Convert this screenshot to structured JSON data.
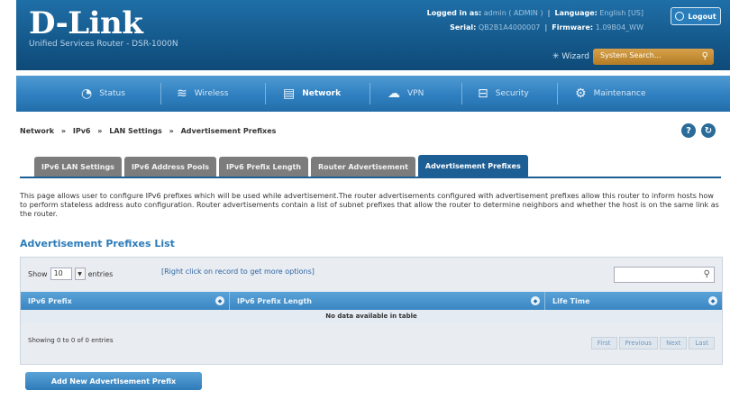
{
  "header": {
    "brand": "D-Link",
    "subtitle": "Unified Services Router - DSR-1000N",
    "logged_in_label": "Logged in as:",
    "logged_in_value": "admin ( ADMIN )",
    "language_label": "Language:",
    "language_value": "English [US]",
    "serial_label": "Serial:",
    "serial_value": "QB2B1A4000007",
    "firmware_label": "Firmware:",
    "firmware_value": "1.09B04_WW",
    "logout_label": "Logout",
    "wizard_label": "Wizard",
    "search_placeholder": "System Search..."
  },
  "nav": {
    "items": [
      {
        "label": "Status",
        "icon": "dashboard-icon"
      },
      {
        "label": "Wireless",
        "icon": "wifi-icon"
      },
      {
        "label": "Network",
        "icon": "network-icon"
      },
      {
        "label": "VPN",
        "icon": "cloud-icon"
      },
      {
        "label": "Security",
        "icon": "lock-icon"
      },
      {
        "label": "Maintenance",
        "icon": "gear-icon"
      }
    ],
    "active": "Network"
  },
  "breadcrumb": [
    "Network",
    "»",
    "IPv6",
    "»",
    "LAN Settings",
    "»",
    "Advertisement Prefixes"
  ],
  "tabs": [
    {
      "label": "IPv6 LAN Settings"
    },
    {
      "label": "IPv6 Address Pools"
    },
    {
      "label": "IPv6 Prefix Length"
    },
    {
      "label": "Router Advertisement"
    },
    {
      "label": "Advertisement Prefixes"
    }
  ],
  "description": "This page allows user to configure IPv6 prefixes which will be used while advertisement.The router advertisements configured with advertisement prefixes allow this router to inform hosts how to perform stateless address auto configuration. Router advertisements contain a list of subnet prefixes that allow the router to determine neighbors and whether the host is on the same link as the router.",
  "section_title": "Advertisement Prefixes List",
  "table": {
    "show_label": "Show",
    "show_value": "10",
    "entries_label": "entries",
    "hint": "[Right click on record to get more options]",
    "columns": [
      "IPv6 Prefix",
      "IPv6 Prefix Length",
      "Life Time"
    ],
    "empty_message": "No data available in table",
    "showing": "Showing 0 to 0 of 0 entries",
    "pager": [
      "First",
      "Previous",
      "Next",
      "Last"
    ]
  },
  "add_button": "Add New Advertisement Prefix",
  "colors": {
    "header_blue": "#155a8c",
    "nav_blue": "#2f7fc0",
    "active_tab": "#1d5f95",
    "tab_gray": "#7c7c7c",
    "link_blue": "#2b7bb9",
    "search_orange": "#c48d36"
  }
}
